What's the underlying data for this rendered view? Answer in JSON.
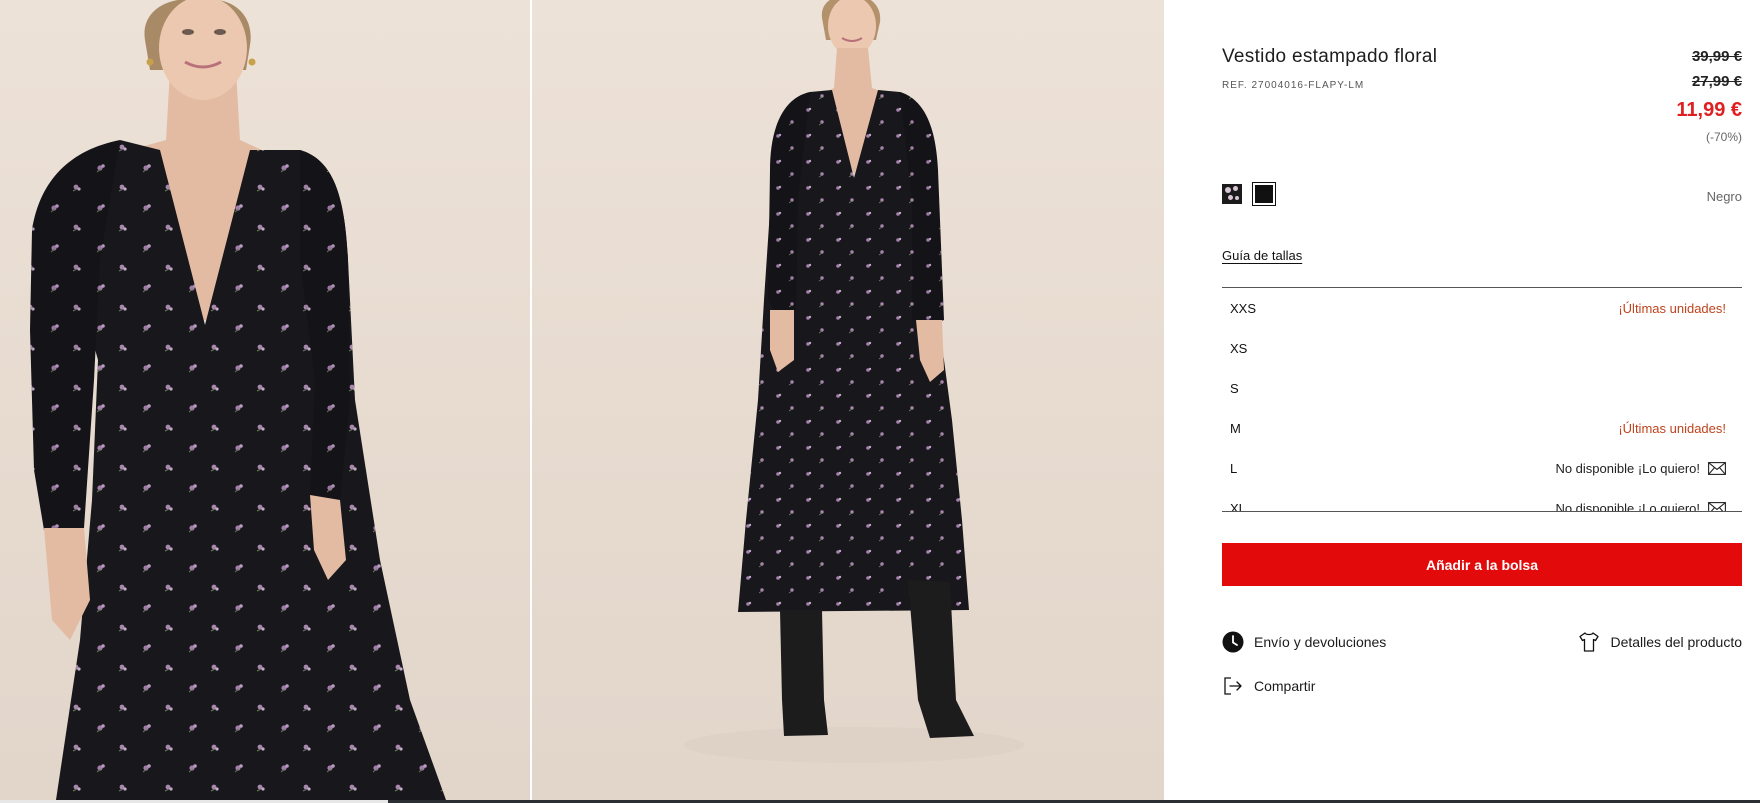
{
  "product": {
    "title": "Vestido estampado floral",
    "reference": "REF. 27004016-FLAPY-LM"
  },
  "prices": {
    "original_1": "39,99 €",
    "original_2": "27,99 €",
    "current": "11,99 €",
    "discount": "(-70%)",
    "current_color": "#e02020"
  },
  "colors": {
    "selected_name": "Negro",
    "swatches": [
      "floral-print",
      "black"
    ]
  },
  "size_guide_label": "Guía de tallas",
  "sizes": [
    {
      "label": "XXS",
      "status": "¡Últimas unidades!"
    },
    {
      "label": "XS",
      "status": ""
    },
    {
      "label": "S",
      "status": ""
    },
    {
      "label": "M",
      "status": "¡Últimas unidades!"
    },
    {
      "label": "L",
      "status": "No disponible ¡Lo quiero!",
      "icon": "mail-icon"
    },
    {
      "label": "XL",
      "status": "No disponible ¡Lo quiero!",
      "icon": "mail-icon"
    }
  ],
  "add_to_bag_label": "Añadir a la bolsa",
  "add_to_bag_color": "#e20a0a",
  "links": {
    "shipping": "Envío y devoluciones",
    "details": "Detalles del producto",
    "share": "Compartir"
  }
}
